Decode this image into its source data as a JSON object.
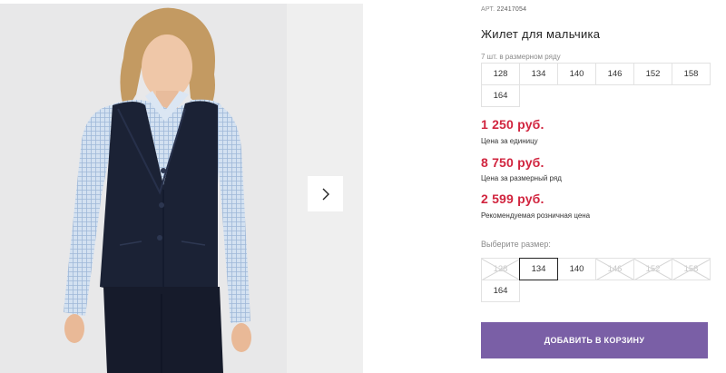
{
  "gallery": {
    "photo_alt": "photo-boy-in-vest",
    "next_icon": "chevron-right-icon"
  },
  "product": {
    "article_label": "АРТ.",
    "article_value": "22417054",
    "title": "Жилет для мальчика"
  },
  "size_range": {
    "label": "7 шт. в размерном ряду",
    "sizes": [
      "128",
      "134",
      "140",
      "146",
      "152",
      "158",
      "164"
    ]
  },
  "prices": [
    {
      "value": "1 250 руб.",
      "caption": "Цена за единицу"
    },
    {
      "value": "8 750 руб.",
      "caption": "Цена за размерный ряд"
    },
    {
      "value": "2 599 руб.",
      "caption": "Рекомендуемая розничная цена"
    }
  ],
  "size_picker": {
    "label": "Выберите размер:",
    "options": [
      {
        "size": "128",
        "state": "unavailable"
      },
      {
        "size": "134",
        "state": "selected"
      },
      {
        "size": "140",
        "state": "available"
      },
      {
        "size": "146",
        "state": "unavailable"
      },
      {
        "size": "152",
        "state": "unavailable"
      },
      {
        "size": "158",
        "state": "unavailable"
      },
      {
        "size": "164",
        "state": "available"
      }
    ]
  },
  "cart": {
    "button_label": "ДОБАВИТЬ В КОРЗИНУ"
  },
  "colors": {
    "price": "#d1253f",
    "button": "#7a5fa6",
    "vest": "#1b2235",
    "shirt": "#c6d8ec"
  }
}
